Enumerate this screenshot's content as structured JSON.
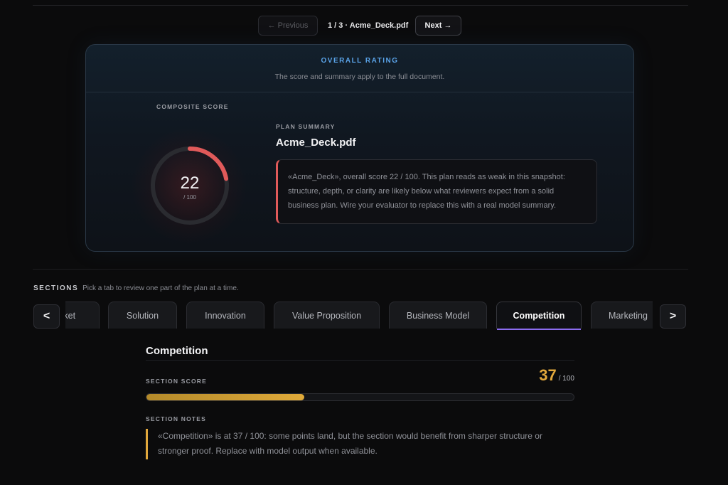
{
  "pager": {
    "prev_label": "← Previous",
    "page_info": "1 / 3 · Acme_Deck.pdf",
    "next_label": "Next →"
  },
  "overall": {
    "kicker": "OVERALL RATING",
    "subtitle": "The score and summary apply to the full document.",
    "composite_label": "COMPOSITE SCORE",
    "score": 22,
    "score_max": "/ 100",
    "plan_label": "PLAN SUMMARY",
    "plan_title": "Acme_Deck.pdf",
    "summary": "«Acme_Deck», overall score 22 / 100. This plan reads as weak in this snapshot: structure, depth, or clarity are likely below what reviewers expect from a solid business plan. Wire your evaluator to replace this with a real model summary."
  },
  "sections": {
    "kicker": "SECTIONS",
    "hint": "Pick a tab to review one part of the plan at a time.",
    "prev_arrow": "<",
    "next_arrow": ">",
    "tabs": [
      {
        "label": "Market"
      },
      {
        "label": "Solution"
      },
      {
        "label": "Innovation"
      },
      {
        "label": "Value Proposition"
      },
      {
        "label": "Business Model"
      },
      {
        "label": "Competition"
      },
      {
        "label": "Marketing"
      }
    ],
    "active_tab": "Competition"
  },
  "section_detail": {
    "title": "Competition",
    "score_label": "SECTION SCORE",
    "score": "37",
    "score_max": "/ 100",
    "score_fraction": 0.37,
    "notes_label": "SECTION NOTES",
    "notes": "«Competition» is at 37 / 100: some points land, but the section would benefit from sharper structure or stronger proof. Replace with model output when available."
  },
  "colors": {
    "gauge_accent": "#e05a5a",
    "section_accent": "#e2a83c",
    "active_tab_underline": "#8b6cf0",
    "kicker_blue": "#5aa3e8"
  }
}
